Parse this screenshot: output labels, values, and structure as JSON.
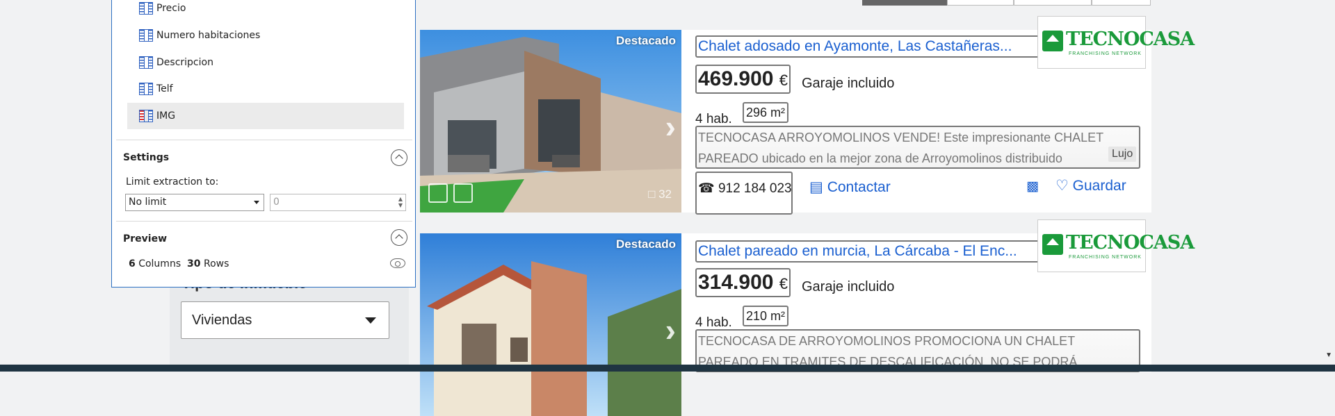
{
  "extraction_panel": {
    "columns": [
      {
        "label": "Precio",
        "selected": false
      },
      {
        "label": "Numero habitaciones",
        "selected": false
      },
      {
        "label": "Descripcion",
        "selected": false
      },
      {
        "label": "Telf",
        "selected": false
      },
      {
        "label": "IMG",
        "selected": true
      }
    ],
    "settings": {
      "title": "Settings",
      "limit_label": "Limit extraction to:",
      "limit_value": "No limit",
      "limit_number": "0"
    },
    "preview": {
      "title": "Preview",
      "columns_count": "6",
      "columns_word": "Columns",
      "rows_count": "30",
      "rows_word": "Rows"
    }
  },
  "sidebar": {
    "filter_label": "Tipo de inmueble",
    "filter_value": "Viviendas"
  },
  "listings": [
    {
      "badge": "Destacado",
      "title": "Chalet adosado en Ayamonte, Las Castañeras...",
      "price": "469.900",
      "currency": "€",
      "parking": "Garaje incluido",
      "rooms": "4 hab.",
      "size": "296 m²",
      "description": "TECNOCASA ARROYOMOLINOS VENDE! Este impresionante CHALET PAREADO ubicado en la mejor zona de Arroyomolinos distribuido",
      "tag": "Lujo",
      "phone": "912 184 023",
      "contact_label": "Contactar",
      "save_label": "Guardar",
      "photo_count": "32",
      "logo_brand": "TECNOCASA",
      "logo_tagline": "FRANCHISING NETWORK"
    },
    {
      "badge": "Destacado",
      "title": "Chalet pareado en murcia, La Cárcaba - El Enc...",
      "price": "314.900",
      "currency": "€",
      "parking": "Garaje incluido",
      "rooms": "4 hab.",
      "size": "210 m²",
      "description": "TECNOCASA DE ARROYOMOLINOS PROMOCIONA UN CHALET PAREADO EN TRAMITES DE DESCALIFICACIÓN, NO SE PODRÁ",
      "logo_brand": "TECNOCASA",
      "logo_tagline": "FRANCHISING NETWORK"
    }
  ],
  "colors": {
    "link_blue": "#1a5fd0",
    "panel_border": "#2b6fc2",
    "brand_green": "#1a9a3a"
  },
  "icons": [
    "column-icon",
    "collapse-up-icon",
    "eye-icon",
    "phone-icon",
    "chat-icon",
    "trash-icon",
    "heart-icon",
    "video-icon",
    "map-icon",
    "camera-icon",
    "chevron-right-icon"
  ]
}
